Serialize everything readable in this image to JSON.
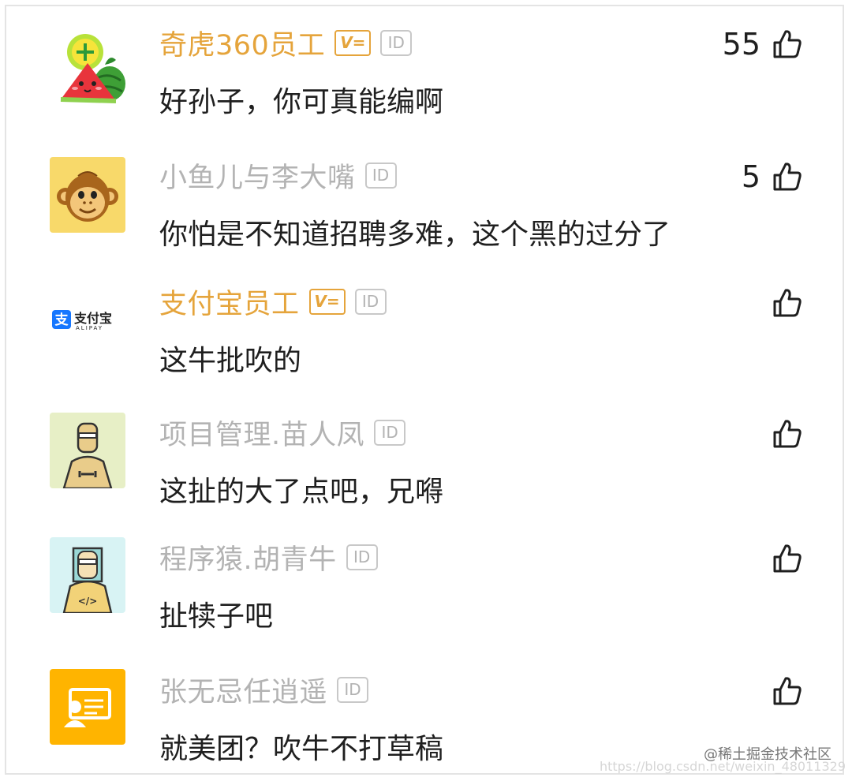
{
  "comments": [
    {
      "username": "奇虎360员工",
      "verified": true,
      "id_label": "ID",
      "text": "好孙子，你可真能编啊",
      "likes": "55",
      "avatar": "watermelon-avatar"
    },
    {
      "username": "小鱼儿与李大嘴",
      "verified": false,
      "id_label": "ID",
      "text": "你怕是不知道招聘多难，这个黑的过分了",
      "likes": "5",
      "avatar": "monkey-avatar"
    },
    {
      "username": "支付宝员工",
      "verified": true,
      "id_label": "ID",
      "text": "这牛批吹的",
      "likes": "",
      "avatar": "alipay-avatar"
    },
    {
      "username": "项目管理.苗人凤",
      "verified": false,
      "id_label": "ID",
      "text": "这扯的大了点吧，兄嘚",
      "likes": "",
      "avatar": "engineer-avatar"
    },
    {
      "username": "程序猿.胡青牛",
      "verified": false,
      "id_label": "ID",
      "text": "扯犊子吧",
      "likes": "",
      "avatar": "programmer-avatar"
    },
    {
      "username": "张无忌任逍遥",
      "verified": false,
      "id_label": "ID",
      "text": "就美团？吹牛不打草稿",
      "likes": "",
      "avatar": "id-card-avatar"
    }
  ],
  "alipay": {
    "brand_cn": "支付宝",
    "brand_en": "ALIPAY",
    "glyph": "支"
  },
  "programmer_tag": "</>",
  "watermelon_plus": "+",
  "verified_badge_label": "V=",
  "watermark": {
    "line1": "@稀土掘金技术社区",
    "line2": "https://blog.csdn.net/weixin_48011329"
  },
  "colors": {
    "verified": "#e5a43b",
    "muted": "#b3b3b3",
    "text": "#1f1f1f"
  }
}
